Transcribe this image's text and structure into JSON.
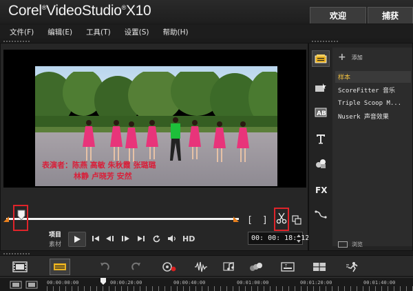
{
  "app": {
    "brand": "Corel",
    "product": "VideoStudio",
    "version": "X10"
  },
  "top_tabs": {
    "welcome": "欢迎",
    "capture": "捕获"
  },
  "menu": [
    {
      "label": "文件(F)"
    },
    {
      "label": "编辑(E)"
    },
    {
      "label": "工具(T)"
    },
    {
      "label": "设置(S)"
    },
    {
      "label": "帮助(H)"
    }
  ],
  "player": {
    "credits_line1": "表演者：陈燕 高敏 朱秋霞 张璐璐",
    "credits_line2": "林静 卢晓芳 安然",
    "mark_in": "[",
    "mark_out": "]",
    "mode_project": "项目",
    "mode_clip": "素材",
    "hd": "HD",
    "timecode": "00: 00: 18: 12"
  },
  "library": {
    "add_label": "添加",
    "items": [
      {
        "label": "样本"
      },
      {
        "label": "ScoreFitter 音乐"
      },
      {
        "label": "Triple Scoop M..."
      },
      {
        "label": "Nuserk 声音效果"
      }
    ],
    "browse_label": "浏览",
    "side_icons": [
      "media-icon",
      "instant-project-icon",
      "transition-icon",
      "title-icon",
      "graphic-icon",
      "fx-icon",
      "path-icon"
    ]
  },
  "ruler": {
    "ticks": [
      "00:00:00:00",
      "00:00:20:00",
      "00:00:40:00",
      "00:01:00:00",
      "00:01:20:00",
      "00:01:40:00"
    ]
  },
  "colors": {
    "accent_orange": "#e8801e",
    "highlight_red": "#e0242a",
    "selected_text": "#f0c040"
  }
}
